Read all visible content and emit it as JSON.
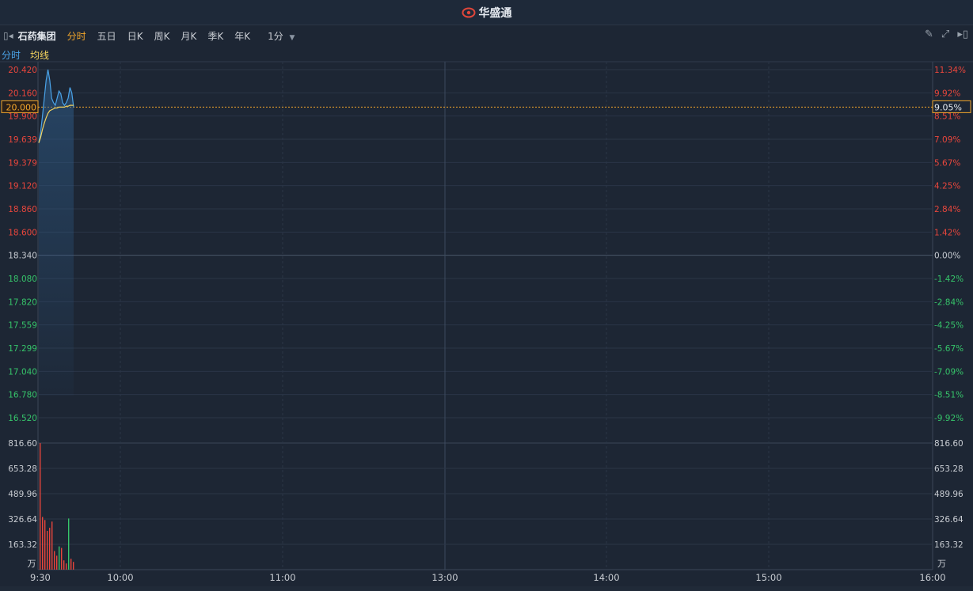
{
  "header": {
    "brand_name": "华盛通",
    "brand_color": "#e0463a"
  },
  "toolbar": {
    "stock_name": "石药集团",
    "tabs": [
      "分时",
      "五日",
      "日K",
      "周K",
      "月K",
      "季K",
      "年K"
    ],
    "active_tab": "分时",
    "interval": "1分",
    "icons": [
      "collapse-left-icon",
      "pencil-icon",
      "expand-icon",
      "collapse-right-icon"
    ]
  },
  "legend": {
    "line_label": "分时",
    "avg_label": "均线",
    "line_color": "#4aa3e8",
    "avg_color": "#f4d35e"
  },
  "chart_data": {
    "type": "line",
    "prev_close": 18.34,
    "current_price_label": "20.000",
    "current_pct_label": "9.05%",
    "price_ticks": [
      "20.420",
      "20.160",
      "19.900",
      "19.639",
      "19.379",
      "19.120",
      "18.860",
      "18.600",
      "18.340",
      "18.080",
      "17.820",
      "17.559",
      "17.299",
      "17.040",
      "16.780",
      "16.520"
    ],
    "pct_ticks": [
      "11.34%",
      "9.92%",
      "8.51%",
      "7.09%",
      "5.67%",
      "4.25%",
      "2.84%",
      "1.42%",
      "0.00%",
      "-1.42%",
      "-2.84%",
      "-4.25%",
      "-5.67%",
      "-7.09%",
      "-8.51%",
      "-9.92%"
    ],
    "ylim": [
      16.52,
      20.42
    ],
    "time_labels": [
      "9:30",
      "10:00",
      "11:00",
      "13:00",
      "14:00",
      "15:00",
      "16:00"
    ],
    "price_series": [
      19.6,
      19.72,
      19.9,
      20.1,
      20.3,
      20.42,
      20.3,
      20.1,
      20.05,
      20.02,
      20.1,
      20.18,
      20.15,
      20.05,
      20.02,
      20.05,
      20.1,
      20.22,
      20.16,
      20.0
    ],
    "avg_series": [
      19.6,
      19.66,
      19.75,
      19.82,
      19.88,
      19.93,
      19.96,
      19.97,
      19.98,
      19.99,
      19.99,
      20.0,
      20.0,
      20.0,
      20.0,
      20.01,
      20.01,
      20.02,
      20.02,
      20.02
    ],
    "volume_ticks": [
      "816.60",
      "653.28",
      "489.96",
      "326.64",
      "163.32"
    ],
    "volume_unit": "万",
    "volume_max": 816.6,
    "volume_series": [
      816,
      340,
      320,
      250,
      270,
      310,
      120,
      90,
      150,
      140,
      60,
      40,
      330,
      70,
      50
    ],
    "volume_colors": [
      "red",
      "red",
      "red",
      "red",
      "red",
      "red",
      "red",
      "red",
      "green",
      "red",
      "red",
      "red",
      "green",
      "red",
      "red"
    ],
    "up_color": "#e8463c",
    "down_color": "#36c46a"
  }
}
